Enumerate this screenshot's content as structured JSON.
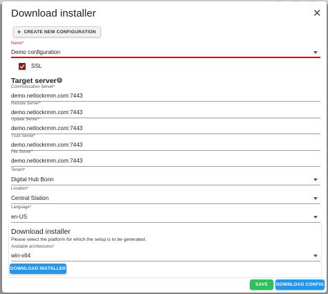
{
  "dialog": {
    "title": "Download installer",
    "close_icon": "close-icon"
  },
  "toolbar": {
    "create_label": "CREATE NEW CONFIGURATION",
    "create_icon": "plus-icon"
  },
  "name_field": {
    "label": "Name*",
    "value": "Demo configuration"
  },
  "ssl": {
    "label": "SSL",
    "checked": true
  },
  "target_server": {
    "title": "Target server",
    "info_icon": "info-icon",
    "communication": {
      "label": "Communication Server*",
      "value": "demo.netlockrmm.com:7443"
    },
    "remote": {
      "label": "Remote Server*",
      "value": "demo.netlockrmm.com:7443"
    },
    "update": {
      "label": "Update Server*",
      "value": "demo.netlockrmm.com:7443"
    },
    "trust": {
      "label": "Trust Server*",
      "value": "demo.netlockrmm.com:7443"
    },
    "file": {
      "label": "File Server*",
      "value": "demo.netlockrmm.com:7443"
    }
  },
  "tenant": {
    "label": "Tenant*",
    "value": "Digital Hub Bonn"
  },
  "location": {
    "label": "Location*",
    "value": "Central Station"
  },
  "language": {
    "label": "Language*",
    "value": "en-US"
  },
  "installer_card": {
    "title": "Download installer",
    "description": "Please select the platform for which the setup is to be generated.",
    "arch_label": "Available architectures*",
    "arch_value": "win-x64",
    "download_label": "DOWNLOAD INSTALLER"
  },
  "footer": {
    "save_label": "SAVE",
    "download_config_label": "DOWNLOAD CONFIG"
  },
  "colors": {
    "accent_red": "#8b1a1a",
    "primary_blue": "#2196f3",
    "success_green": "#2ec05a"
  }
}
